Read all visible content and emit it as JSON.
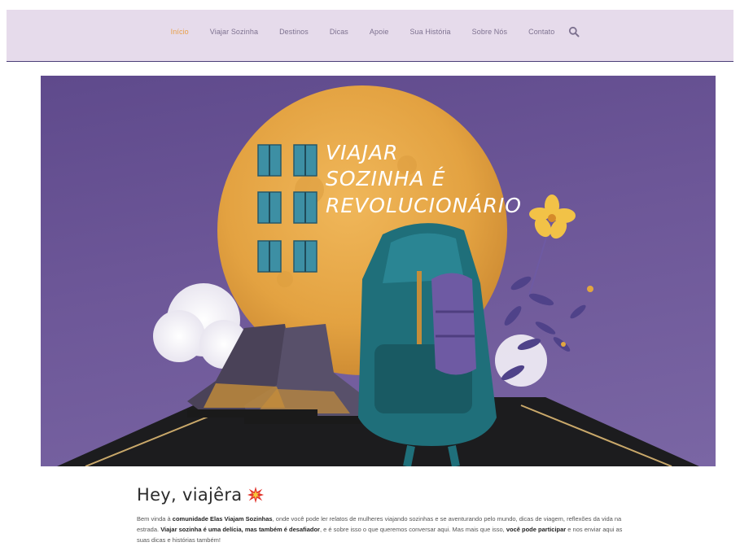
{
  "nav": {
    "items": [
      {
        "label": "Início",
        "active": true
      },
      {
        "label": "Viajar Sozinha",
        "active": false
      },
      {
        "label": "Destinos",
        "active": false
      },
      {
        "label": "Dicas",
        "active": false
      },
      {
        "label": "Apoie",
        "active": false
      },
      {
        "label": "Sua História",
        "active": false
      },
      {
        "label": "Sobre Nós",
        "active": false
      },
      {
        "label": "Contato",
        "active": false
      }
    ],
    "search_icon": "search-icon",
    "active_color": "#e8a04a",
    "bar_color": "#e6dbeb"
  },
  "hero": {
    "headline_lines": [
      "VIAJAR",
      "SOZINHA É",
      "REVOLUCIONÁRIO"
    ],
    "moon_color": "#e4a443",
    "background_color": "#6d5798"
  },
  "intro": {
    "title": "Hey, viajêra",
    "title_icon": "burst-icon",
    "paragraph": {
      "p1": "Bem vinda à ",
      "b1": "comunidade Elas Viajam Sozinhas",
      "p2": ", onde você pode ler relatos de mulheres viajando sozinhas e se aventurando pelo mundo, dicas de viagem, reflexões da vida na estrada. ",
      "b2": "Viajar sozinha é uma delícia, mas também é desafiador",
      "p3": ", e é sobre isso o que queremos conversar aqui. Mas mais que isso, ",
      "b3": "você pode participar",
      "p4": " e nos enviar aqui as suas dicas e histórias também!"
    }
  }
}
